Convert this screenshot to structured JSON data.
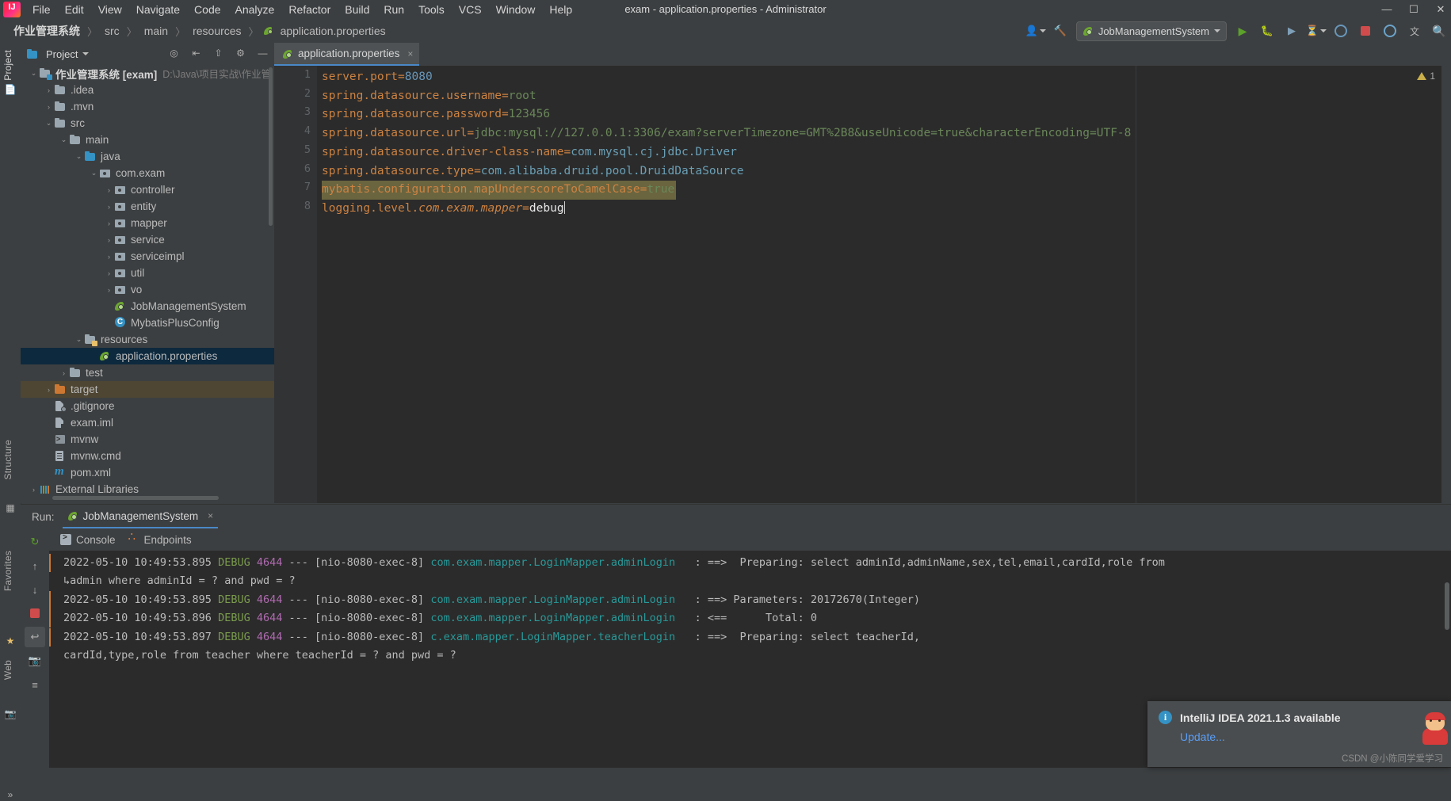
{
  "window": {
    "title": "exam - application.properties - Administrator",
    "controls": [
      "minimize",
      "maximize",
      "close"
    ],
    "control_glyphs": [
      "—",
      "☐",
      "✕"
    ]
  },
  "menubar": {
    "items": [
      "File",
      "Edit",
      "View",
      "Navigate",
      "Code",
      "Analyze",
      "Refactor",
      "Build",
      "Run",
      "Tools",
      "VCS",
      "Window",
      "Help"
    ]
  },
  "navbar": {
    "breadcrumbs": [
      "作业管理系统",
      "src",
      "main",
      "resources",
      "application.properties"
    ],
    "separator": "〉",
    "run_config": "JobManagementSystem",
    "icons": [
      "user-icon",
      "hammer-icon",
      "run-icon",
      "debug-icon",
      "coverage-icon",
      "profile-icon",
      "search-everywhere-icon",
      "stop-icon",
      "help-icon",
      "translate-icon"
    ]
  },
  "left_strip": {
    "project_tab": "Project",
    "structure_tab": "Structure",
    "favorites_tab": "Favorites",
    "web_tab": "Web"
  },
  "project_panel": {
    "title": "Project",
    "header_icons": [
      "locate-icon",
      "collapse-all-icon",
      "expand-icon",
      "settings-icon",
      "hide-icon"
    ],
    "tree": [
      {
        "indent": 0,
        "arrow": "down",
        "icon": "module-folder",
        "label": "作业管理系统 [exam]",
        "bold": true,
        "path": "D:\\Java\\项目实战\\作业管",
        "state": "normal"
      },
      {
        "indent": 1,
        "arrow": "right",
        "icon": "folder",
        "label": ".idea",
        "state": "normal"
      },
      {
        "indent": 1,
        "arrow": "right",
        "icon": "folder",
        "label": ".mvn",
        "state": "normal"
      },
      {
        "indent": 1,
        "arrow": "down",
        "icon": "folder",
        "label": "src",
        "state": "normal"
      },
      {
        "indent": 2,
        "arrow": "down",
        "icon": "folder",
        "label": "main",
        "state": "normal"
      },
      {
        "indent": 3,
        "arrow": "down",
        "icon": "folder-source",
        "label": "java",
        "state": "normal"
      },
      {
        "indent": 4,
        "arrow": "down",
        "icon": "package",
        "label": "com.exam",
        "state": "normal"
      },
      {
        "indent": 5,
        "arrow": "right",
        "icon": "package",
        "label": "controller",
        "state": "normal"
      },
      {
        "indent": 5,
        "arrow": "right",
        "icon": "package",
        "label": "entity",
        "state": "normal"
      },
      {
        "indent": 5,
        "arrow": "right",
        "icon": "package",
        "label": "mapper",
        "state": "normal"
      },
      {
        "indent": 5,
        "arrow": "right",
        "icon": "package",
        "label": "service",
        "state": "normal"
      },
      {
        "indent": 5,
        "arrow": "right",
        "icon": "package",
        "label": "serviceimpl",
        "state": "normal"
      },
      {
        "indent": 5,
        "arrow": "right",
        "icon": "package",
        "label": "util",
        "state": "normal"
      },
      {
        "indent": 5,
        "arrow": "right",
        "icon": "package",
        "label": "vo",
        "state": "normal"
      },
      {
        "indent": 5,
        "arrow": "none",
        "icon": "spring-class",
        "label": "JobManagementSystem",
        "state": "normal"
      },
      {
        "indent": 5,
        "arrow": "none",
        "icon": "java-class",
        "label": "MybatisPlusConfig",
        "state": "normal"
      },
      {
        "indent": 3,
        "arrow": "down",
        "icon": "folder-resource",
        "label": "resources",
        "state": "normal"
      },
      {
        "indent": 4,
        "arrow": "none",
        "icon": "spring-props",
        "label": "application.properties",
        "state": "selected"
      },
      {
        "indent": 2,
        "arrow": "right",
        "icon": "folder",
        "label": "test",
        "state": "normal"
      },
      {
        "indent": 1,
        "arrow": "right",
        "icon": "folder-excluded",
        "label": "target",
        "state": "targeted"
      },
      {
        "indent": 1,
        "arrow": "none",
        "icon": "gitignore-file",
        "label": ".gitignore",
        "state": "normal"
      },
      {
        "indent": 1,
        "arrow": "none",
        "icon": "iml-file",
        "label": "exam.iml",
        "state": "normal"
      },
      {
        "indent": 1,
        "arrow": "none",
        "icon": "shell-file",
        "label": "mvnw",
        "state": "normal"
      },
      {
        "indent": 1,
        "arrow": "none",
        "icon": "cmd-file",
        "label": "mvnw.cmd",
        "state": "normal"
      },
      {
        "indent": 1,
        "arrow": "none",
        "icon": "maven-file",
        "label": "pom.xml",
        "state": "normal"
      },
      {
        "indent": 0,
        "arrow": "right",
        "icon": "libraries",
        "label": "External Libraries",
        "state": "normal"
      }
    ]
  },
  "editor": {
    "tab": {
      "label": "application.properties",
      "close": "×",
      "icon": "spring-properties-icon"
    },
    "warning_count": "1",
    "lines": [
      {
        "no": "1",
        "highlight": false,
        "segments": [
          {
            "t": "server.port",
            "c": "k"
          },
          {
            "t": "=",
            "c": "k"
          },
          {
            "t": "8080",
            "c": "vnum"
          }
        ]
      },
      {
        "no": "2",
        "highlight": false,
        "segments": [
          {
            "t": "spring.datasource.username",
            "c": "k"
          },
          {
            "t": "=",
            "c": "k"
          },
          {
            "t": "root",
            "c": "v"
          }
        ]
      },
      {
        "no": "3",
        "highlight": false,
        "segments": [
          {
            "t": "spring.datasource.password",
            "c": "k"
          },
          {
            "t": "=",
            "c": "k"
          },
          {
            "t": "123456",
            "c": "v"
          }
        ]
      },
      {
        "no": "4",
        "highlight": false,
        "segments": [
          {
            "t": "spring.datasource.url",
            "c": "k"
          },
          {
            "t": "=",
            "c": "k"
          },
          {
            "t": "jdbc:mysql://127.0.0.1:3306/exam?serverTimezone=GMT%2B8&useUnicode=true&characterEncoding=UTF-8",
            "c": "v"
          }
        ]
      },
      {
        "no": "5",
        "highlight": false,
        "segments": [
          {
            "t": "spring.datasource.driver-class-name",
            "c": "k"
          },
          {
            "t": "=",
            "c": "k"
          },
          {
            "t": "com.mysql.cj.jdbc.Driver",
            "c": "vblue"
          }
        ]
      },
      {
        "no": "6",
        "highlight": false,
        "segments": [
          {
            "t": "spring.datasource.type",
            "c": "k"
          },
          {
            "t": "=",
            "c": "k"
          },
          {
            "t": "com.alibaba.druid.pool.DruidDataSource",
            "c": "vblue"
          }
        ]
      },
      {
        "no": "7",
        "highlight": true,
        "segments": [
          {
            "t": "mybatis.configuration.mapUnderscoreToCamelCase",
            "c": "k"
          },
          {
            "t": "=",
            "c": "k"
          },
          {
            "t": "true",
            "c": "v"
          }
        ]
      },
      {
        "no": "8",
        "highlight": false,
        "segments": [
          {
            "t": "logging.level.",
            "c": "k"
          },
          {
            "t": "com.exam.mapper",
            "c": "it"
          },
          {
            "t": "=",
            "c": "k"
          },
          {
            "t": "debug",
            "c": "wh"
          }
        ]
      }
    ]
  },
  "run_window": {
    "run_label": "Run:",
    "run_tab": "JobManagementSystem",
    "run_tab_close": "×",
    "console_tabs": [
      {
        "label": "Console",
        "icon": "console-icon"
      },
      {
        "label": "Endpoints",
        "icon": "endpoints-icon"
      }
    ],
    "side_icons": [
      "rerun-icon",
      "up-icon",
      "down-icon",
      "stop-icon",
      "soft-wrap-icon",
      "camera-icon",
      "print-icon",
      "scroll-end-icon"
    ],
    "log_lines": [
      {
        "wrap": false,
        "ts": "2022-05-10 10:49:53.895",
        "level": "DEBUG",
        "pid": "4644",
        "sep": "---",
        "thread": "[nio-8080-exec-8]",
        "logger": "com.exam.mapper.LoginMapper.adminLogin",
        "msg": ": ==>  Preparing: select adminId,adminName,sex,tel,email,cardId,role from"
      },
      {
        "wrap": true,
        "text": "↳admin where adminId = ? and pwd = ?"
      },
      {
        "wrap": false,
        "ts": "2022-05-10 10:49:53.895",
        "level": "DEBUG",
        "pid": "4644",
        "sep": "---",
        "thread": "[nio-8080-exec-8]",
        "logger": "com.exam.mapper.LoginMapper.adminLogin",
        "msg": ": ==> Parameters: 20172670(Integer)"
      },
      {
        "wrap": false,
        "ts": "2022-05-10 10:49:53.896",
        "level": "DEBUG",
        "pid": "4644",
        "sep": "---",
        "thread": "[nio-8080-exec-8]",
        "logger": "com.exam.mapper.LoginMapper.adminLogin",
        "msg": ": <==      Total: 0"
      },
      {
        "wrap": false,
        "ts": "2022-05-10 10:49:53.897",
        "level": "DEBUG",
        "pid": "4644",
        "sep": "---",
        "thread": "[nio-8080-exec-8]",
        "logger": "c.exam.mapper.LoginMapper.teacherLogin",
        "msg": ": ==>  Preparing: select teacherId,"
      },
      {
        "wrap": true,
        "text": "cardId,type,role from teacher where teacherId = ? and pwd = ?"
      }
    ]
  },
  "notification": {
    "title": "IntelliJ IDEA 2021.1.3 available",
    "link": "Update...",
    "icon": "info-icon"
  },
  "watermark": "CSDN @小陈同学爱学习",
  "colors": {
    "accent": "#4a88c7",
    "selection": "#0d293e",
    "highlight": "#6a653f",
    "keyword": "#cc8242",
    "string": "#6a8759",
    "number": "#6897bb",
    "debug": "#7a9b4e",
    "logger": "#299999",
    "link": "#589df6"
  }
}
